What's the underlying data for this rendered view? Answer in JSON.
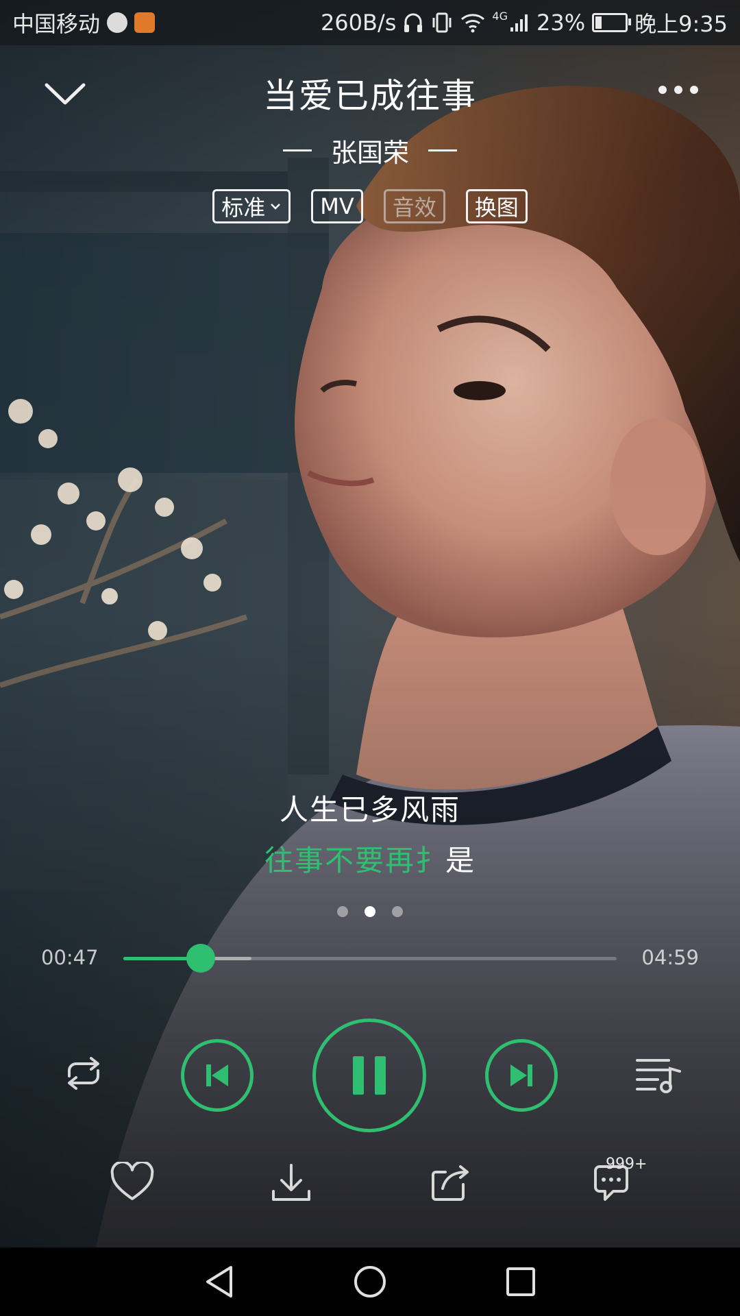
{
  "status_bar": {
    "carrier": "中国移动",
    "speed": "260B/s",
    "network": "4G",
    "battery": "23%",
    "battery_level": 0.23,
    "time": "晚上9:35"
  },
  "header": {
    "song_title": "当爱已成往事",
    "artist": "张国荣"
  },
  "tags": {
    "quality": "标准",
    "mv": "MV",
    "sound_effect": "音效",
    "change_image": "换图"
  },
  "lyrics": {
    "current": "人生已多风雨",
    "next_sung": "往事不要再扌",
    "next_unsung": "是"
  },
  "pager": {
    "count": 3,
    "active_index": 1
  },
  "progress": {
    "elapsed": "00:47",
    "total": "04:59",
    "played_fraction": 0.157,
    "buffered_fraction": 0.26
  },
  "actions": {
    "comment_count": "999+"
  },
  "colors": {
    "accent": "#2fbf71",
    "text": "#ffffff"
  },
  "icons": [
    "chevron-down-icon",
    "more-icon",
    "repeat-icon",
    "previous-icon",
    "pause-icon",
    "next-icon",
    "playlist-icon",
    "heart-icon",
    "download-icon",
    "share-icon",
    "comment-icon",
    "back-icon",
    "home-icon",
    "recents-icon"
  ]
}
